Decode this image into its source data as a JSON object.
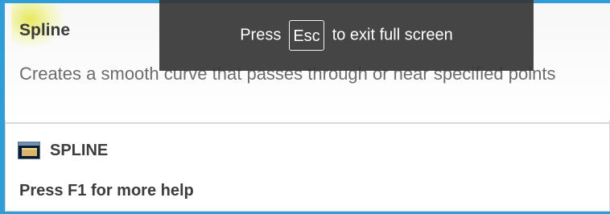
{
  "tooltip": {
    "title": "Spline",
    "description": "Creates a smooth curve that passes through or near specified points",
    "command": "SPLINE",
    "help": "Press F1 for more help",
    "command_icon": "spline-command-icon"
  },
  "fullscreen_notice": {
    "before_key": "Press",
    "key": "Esc",
    "after_key": "to exit full screen"
  },
  "colors": {
    "frame_background": "#2f9ed8",
    "overlay_background": "#353535",
    "highlight": "#e4e641"
  }
}
